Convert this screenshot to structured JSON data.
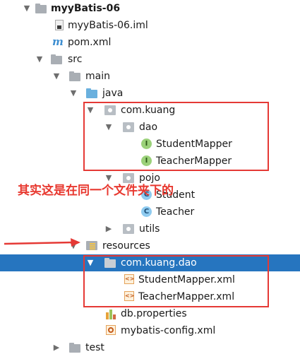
{
  "tree": {
    "project": "myyBatis-06",
    "iml_file": "myyBatis-06.iml",
    "pom": "pom.xml",
    "src": "src",
    "main": "main",
    "java": "java",
    "pkg_com_kuang": "com.kuang",
    "pkg_dao": "dao",
    "student_mapper": "StudentMapper",
    "teacher_mapper": "TeacherMapper",
    "pkg_pojo": "pojo",
    "student": "Student",
    "teacher": "Teacher",
    "pkg_utils": "utils",
    "resources": "resources",
    "res_pkg": "com.kuang.dao",
    "student_mapper_xml": "StudentMapper.xml",
    "teacher_mapper_xml": "TeacherMapper.xml",
    "db_properties": "db.properties",
    "mybatis_config": "mybatis-config.xml",
    "test": "test"
  },
  "icons": {
    "interface_letter": "I",
    "class_letter": "C",
    "xml_glyph": "<>"
  },
  "annotation": {
    "text": "其实这是在同一个文件夹下的",
    "color": "#e8382f"
  },
  "colors": {
    "selection": "#2675bf",
    "highlight_box": "#e53935"
  }
}
